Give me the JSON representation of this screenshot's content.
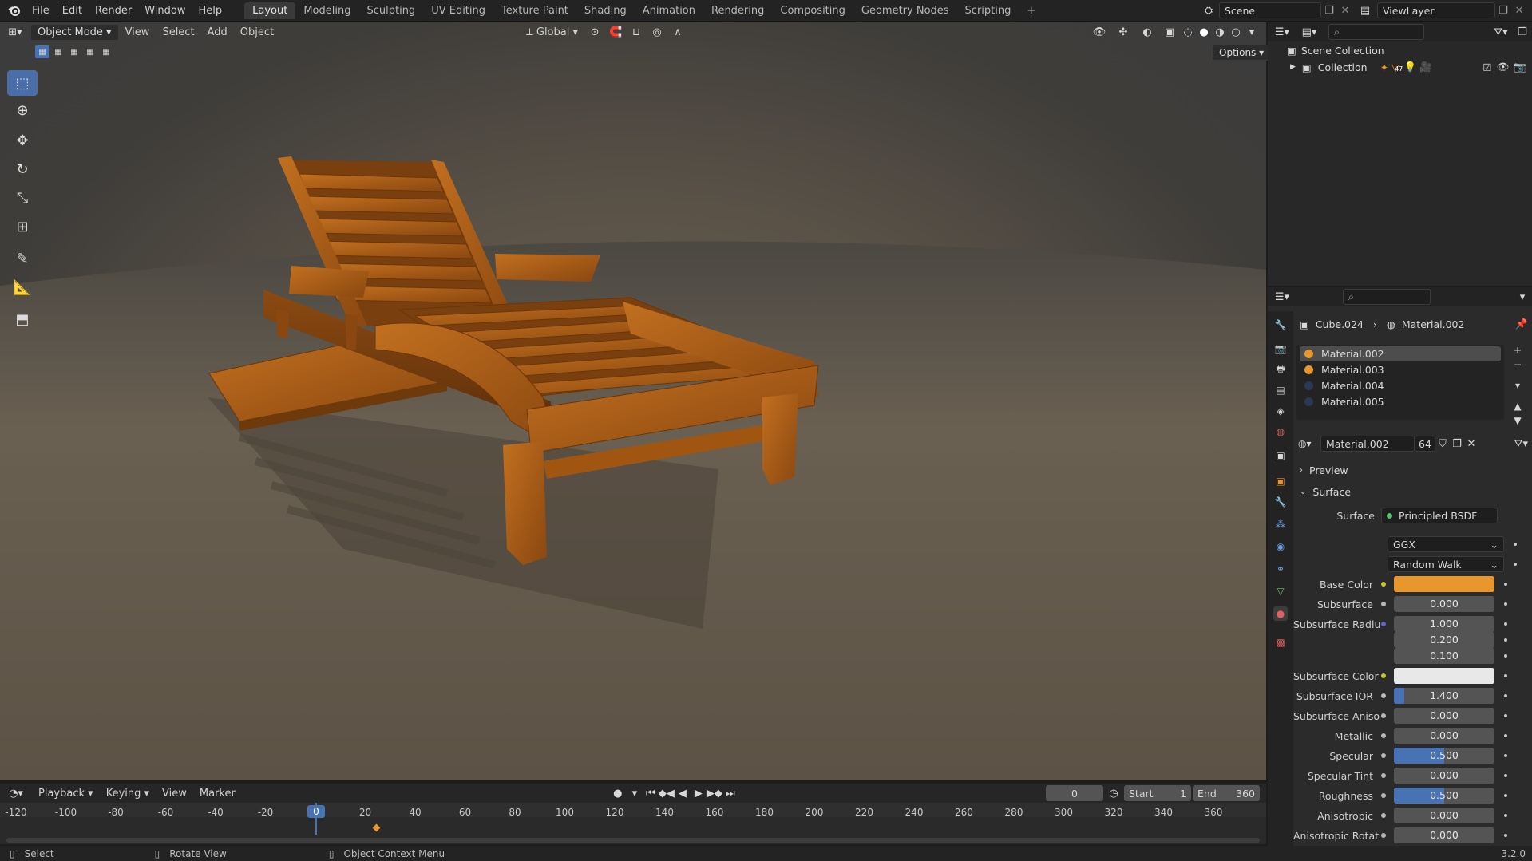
{
  "topbar": {
    "menus": [
      "File",
      "Edit",
      "Render",
      "Window",
      "Help"
    ],
    "workspaces": [
      "Layout",
      "Modeling",
      "Sculpting",
      "UV Editing",
      "Texture Paint",
      "Shading",
      "Animation",
      "Rendering",
      "Compositing",
      "Geometry Nodes",
      "Scripting"
    ],
    "active_workspace": "Layout",
    "scene": "Scene",
    "view_layer": "ViewLayer"
  },
  "viewport_header": {
    "mode": "Object Mode",
    "menus": [
      "View",
      "Select",
      "Add",
      "Object"
    ],
    "orientation": "Global",
    "options": "Options"
  },
  "outliner": {
    "scene_collection": "Scene Collection",
    "collection": "Collection",
    "count_badge": "47"
  },
  "properties": {
    "breadcrumb_object": "Cube.024",
    "breadcrumb_material": "Material.002",
    "materials": [
      "Material.002",
      "Material.003",
      "Material.004",
      "Material.005"
    ],
    "material_name": "Material.002",
    "user_count": "64",
    "sections": {
      "preview": "Preview",
      "surface": "Surface"
    },
    "surface_label": "Surface",
    "surface_shader": "Principled BSDF",
    "distribution": "GGX",
    "subsurface_method": "Random Walk",
    "rows": [
      {
        "label": "Base Color",
        "value": "",
        "color": "#e8962e"
      },
      {
        "label": "Subsurface",
        "value": "0.000",
        "fill": 0
      },
      {
        "label": "Subsurface Radius",
        "value": "1.000",
        "fill": 0
      },
      {
        "label": "",
        "value": "0.200",
        "fill": 0
      },
      {
        "label": "",
        "value": "0.100",
        "fill": 0
      },
      {
        "label": "Subsurface Color",
        "value": "",
        "color": "#e8e8e8"
      },
      {
        "label": "Subsurface IOR",
        "value": "1.400",
        "fill": 0.1
      },
      {
        "label": "Subsurface Anisot...",
        "value": "0.000",
        "fill": 0
      },
      {
        "label": "Metallic",
        "value": "0.000",
        "fill": 0
      },
      {
        "label": "Specular",
        "value": "0.500",
        "fill": 0.5
      },
      {
        "label": "Specular Tint",
        "value": "0.000",
        "fill": 0
      },
      {
        "label": "Roughness",
        "value": "0.500",
        "fill": 0.5
      },
      {
        "label": "Anisotropic",
        "value": "0.000",
        "fill": 0
      },
      {
        "label": "Anisotropic Rotati...",
        "value": "0.000",
        "fill": 0
      }
    ]
  },
  "timeline": {
    "menus": [
      "Playback",
      "Keying",
      "View",
      "Marker"
    ],
    "current_frame": "0",
    "start_label": "Start",
    "start": "1",
    "end_label": "End",
    "end": "360",
    "ticks": [
      "-120",
      "-100",
      "-80",
      "-60",
      "-40",
      "-20",
      "0",
      "20",
      "40",
      "60",
      "80",
      "100",
      "120",
      "140",
      "160",
      "180",
      "200",
      "220",
      "240",
      "260",
      "280",
      "300",
      "320",
      "340",
      "360"
    ]
  },
  "statusbar": {
    "select": "Select",
    "rotate": "Rotate View",
    "context": "Object Context Menu",
    "version": "3.2.0"
  },
  "colors": {
    "accent": "#4772b3",
    "base_color": "#e8962e",
    "wood": "#a85a18"
  }
}
